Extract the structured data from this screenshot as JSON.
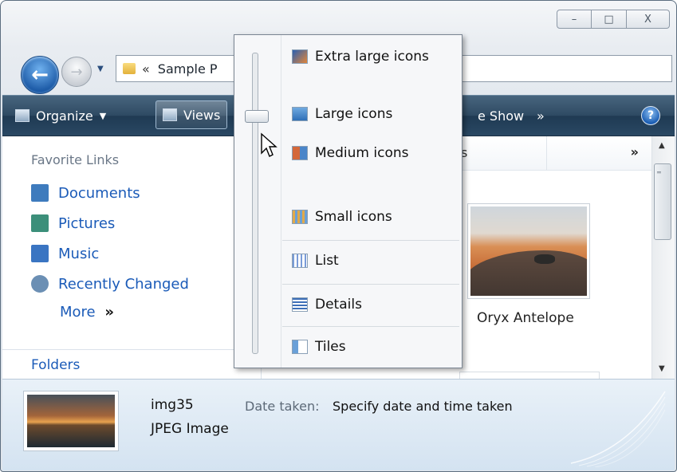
{
  "window": {
    "caption_buttons": {
      "minimize": "–",
      "maximize": "□",
      "close": "X"
    }
  },
  "address": {
    "breadcrumb_chevron": "«",
    "path": "Sample P"
  },
  "toolbar": {
    "organize_label": "Organize",
    "views_label": "Views",
    "slideshow_label": "e Show",
    "overflow": "»",
    "help": "?"
  },
  "sidebar": {
    "title": "Favorite Links",
    "items": [
      {
        "label": "Documents",
        "icon": "documents-icon",
        "color": "#3e7bbd"
      },
      {
        "label": "Pictures",
        "icon": "pictures-icon",
        "color": "#3c8f7a"
      },
      {
        "label": "Music",
        "icon": "music-icon",
        "color": "#3a75c2"
      },
      {
        "label": "Recently Changed",
        "icon": "recently-changed-icon",
        "color": "#6b8fb4"
      }
    ],
    "more_label": "More",
    "more_chevron": "»",
    "folders_label": "Folders"
  },
  "content": {
    "column_partial": "s",
    "column_more": "»",
    "thumbnail_caption": "Oryx Antelope"
  },
  "views_menu": {
    "items": [
      {
        "label": "Extra large icons",
        "icon": "extra-large-icons-icon"
      },
      {
        "label": "Large icons",
        "icon": "large-icons-icon"
      },
      {
        "label": "Medium icons",
        "icon": "medium-icons-icon"
      },
      {
        "label": "Small icons",
        "icon": "small-icons-icon"
      },
      {
        "label": "List",
        "icon": "list-icon"
      },
      {
        "label": "Details",
        "icon": "details-icon"
      },
      {
        "label": "Tiles",
        "icon": "tiles-icon"
      }
    ]
  },
  "details_pane": {
    "file_name": "img35",
    "file_type": "JPEG Image",
    "date_label": "Date taken:",
    "date_value": "Specify date and time taken"
  },
  "colors": {
    "link": "#1b5bb8",
    "toolbar_top": "#48657e",
    "toolbar_bottom": "#1f3a53",
    "details_bg": "#d4e3f1"
  }
}
